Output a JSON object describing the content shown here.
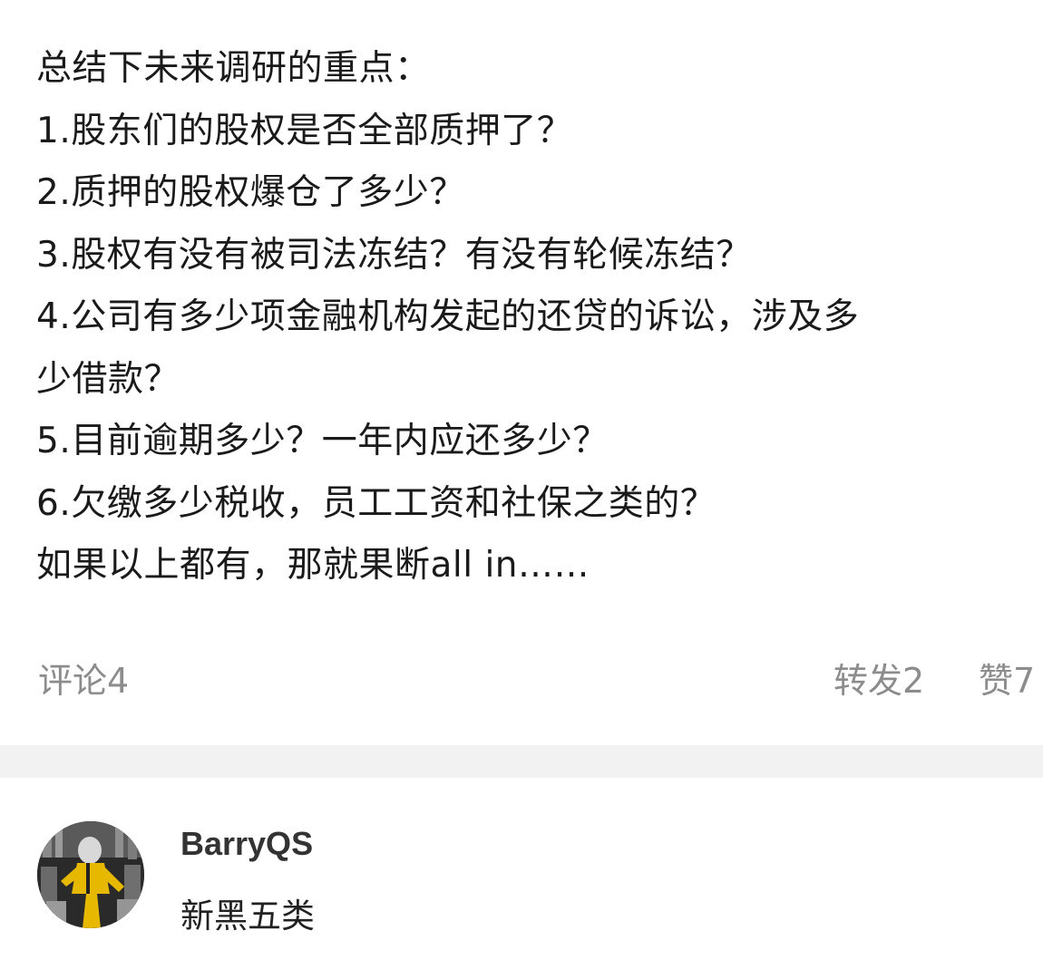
{
  "post": {
    "lines": [
      "总结下未来调研的重点：",
      "1.股东们的股权是否全部质押了？",
      "2.质押的股权爆仓了多少？",
      "3.股权有没有被司法冻结？有没有轮候冻结？",
      "4.公司有多少项金融机构发起的还贷的诉讼，涉及多",
      "少借款？",
      "5.目前逾期多少？一年内应还多少？",
      "6.欠缴多少税收，员工工资和社保之类的？",
      "如果以上都有，那就果断all in……"
    ]
  },
  "actions": {
    "comment_label": "评论4",
    "repost_label": "转发2",
    "like_label": "赞7"
  },
  "user": {
    "name": "BarryQS",
    "tag": "新黑五类",
    "avatar_icon": "avatar-image"
  },
  "colors": {
    "text": "#1a1a1a",
    "muted": "#8c8c8c",
    "divider": "#f2f2f2"
  }
}
